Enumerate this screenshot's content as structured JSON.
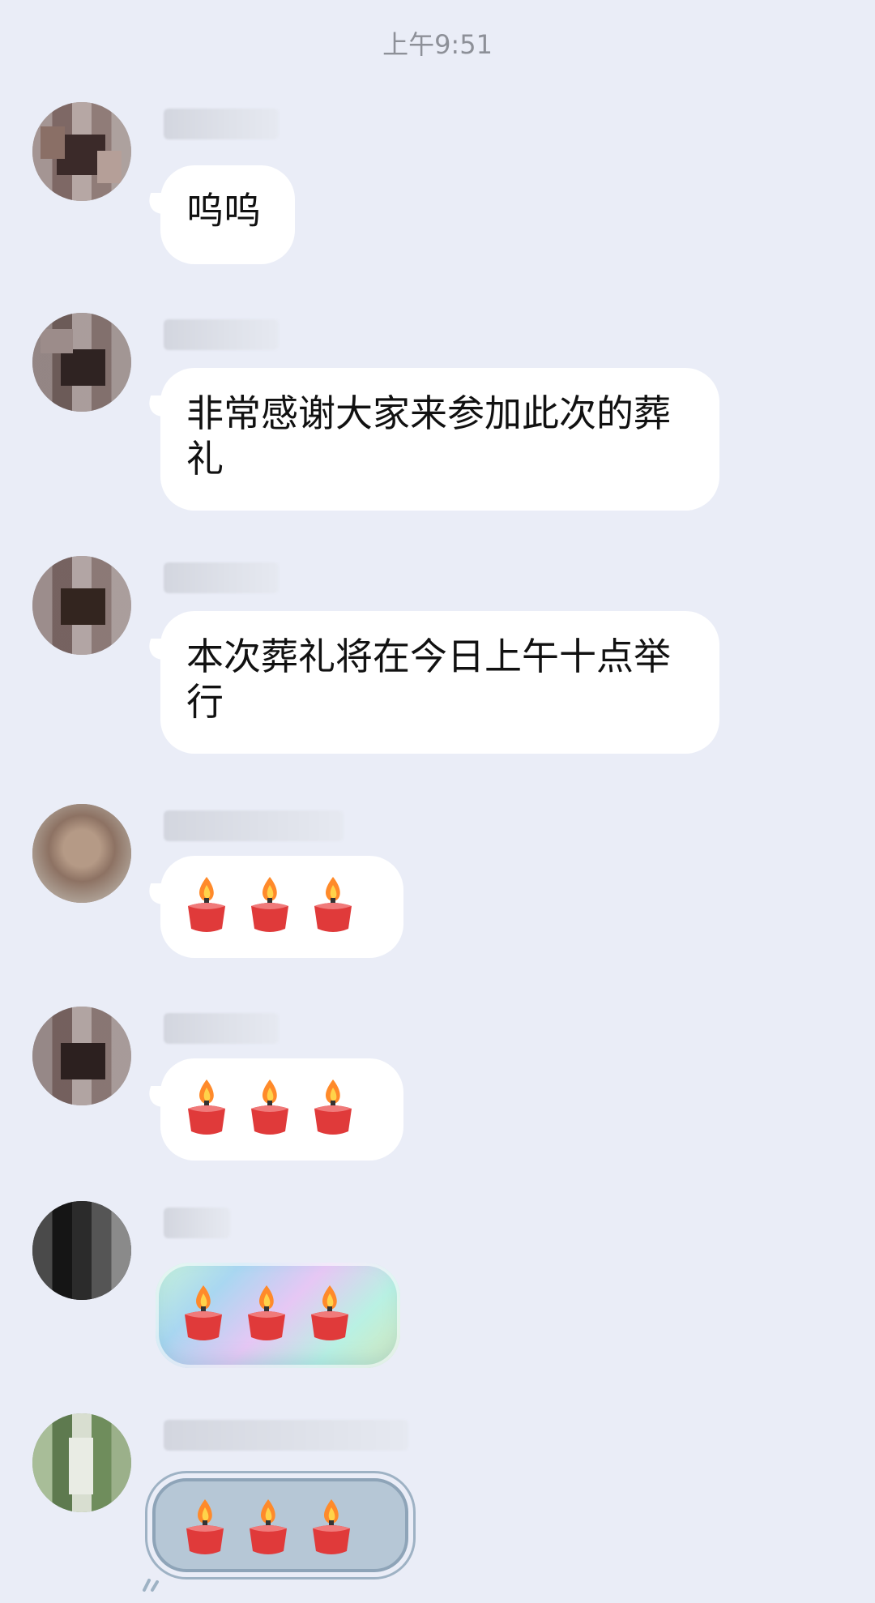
{
  "timestamp": "上午9:51",
  "colors": {
    "background": "#eaedf7",
    "bubble": "#ffffff",
    "candle_body": "#e03a3a",
    "flame": "#ff8a2a"
  },
  "messages": [
    {
      "type": "text",
      "text": "呜呜"
    },
    {
      "type": "text",
      "text": "非常感谢大家来参加此次的葬礼"
    },
    {
      "type": "text",
      "text": "本次葬礼将在今日上午十点举行"
    },
    {
      "type": "emoji",
      "emoji": "candle",
      "count": 3,
      "bubble_style": "plain"
    },
    {
      "type": "emoji",
      "emoji": "candle",
      "count": 3,
      "bubble_style": "plain"
    },
    {
      "type": "emoji",
      "emoji": "candle",
      "count": 3,
      "bubble_style": "rainbow"
    },
    {
      "type": "emoji",
      "emoji": "candle",
      "count": 3,
      "bubble_style": "outline"
    }
  ]
}
